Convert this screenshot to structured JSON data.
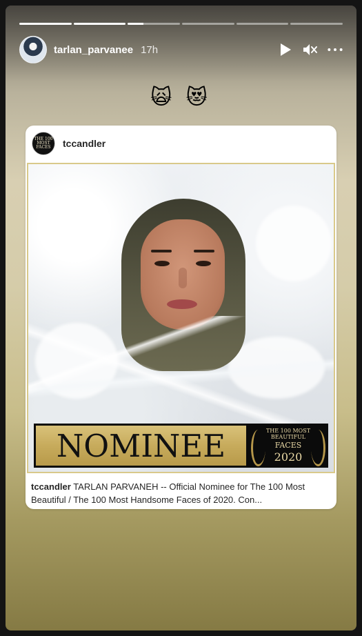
{
  "story": {
    "progress_segments": [
      1,
      1,
      0.3,
      0,
      0,
      0
    ],
    "username": "tarlan_parvanee",
    "time_ago": "17h",
    "emojis": "🙀 😻"
  },
  "shared_post": {
    "username": "tccandler",
    "avatar_text": "THE 100 MOST FACES",
    "banner": {
      "main_text": "NOMINEE",
      "badge_line1": "THE 100 MOST",
      "badge_line2": "BEAUTIFUL",
      "badge_line3": "FACES",
      "badge_year": "2020"
    },
    "caption_user": "tccandler",
    "caption_text": "TARLAN PARVANEH -- Official Nominee for The 100 Most Beautiful / The 100 Most Handsome Faces of 2020.  Con..."
  },
  "icons": {
    "play": "play-icon",
    "mute": "mute-icon",
    "more": "more-icon"
  },
  "colors": {
    "gold": "#c7ab5c",
    "banner_black": "#0b0b0b"
  }
}
